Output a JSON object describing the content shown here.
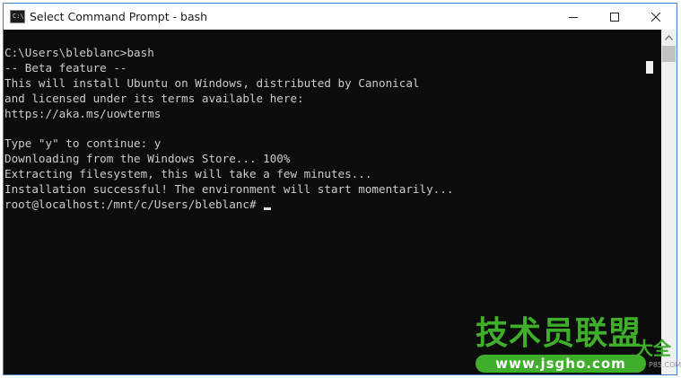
{
  "window": {
    "title": "Select Command Prompt - bash",
    "icon_label": "C:\\",
    "controls": {
      "minimize": "minimize-icon",
      "maximize": "maximize-icon",
      "close": "close-icon"
    }
  },
  "console": {
    "text": "C:\\Users\\bleblanc>bash\n-- Beta feature --\nThis will install Ubuntu on Windows, distributed by Canonical\nand licensed under its terms available here:\nhttps://aka.ms/uowterms\n\nType \"y\" to continue: y\nDownloading from the Windows Store... 100%\nExtracting filesystem, this will take a few minutes...\nInstallation successful! The environment will start momentarily...\nroot@localhost:/mnt/c/Users/bleblanc# "
  },
  "scrollbar": {
    "up_arrow": "chevron-up-icon"
  },
  "watermark": {
    "title": "技术员联盟",
    "side_text": "大全",
    "url": "www.jsgho.com",
    "small_text": "P85.COM"
  },
  "colors": {
    "console_bg": "#0c0c0c",
    "console_text": "#cccccc",
    "titlebar_bg": "#ffffff",
    "window_border": "#4a7fc1",
    "watermark_green": "#3fae2a"
  }
}
